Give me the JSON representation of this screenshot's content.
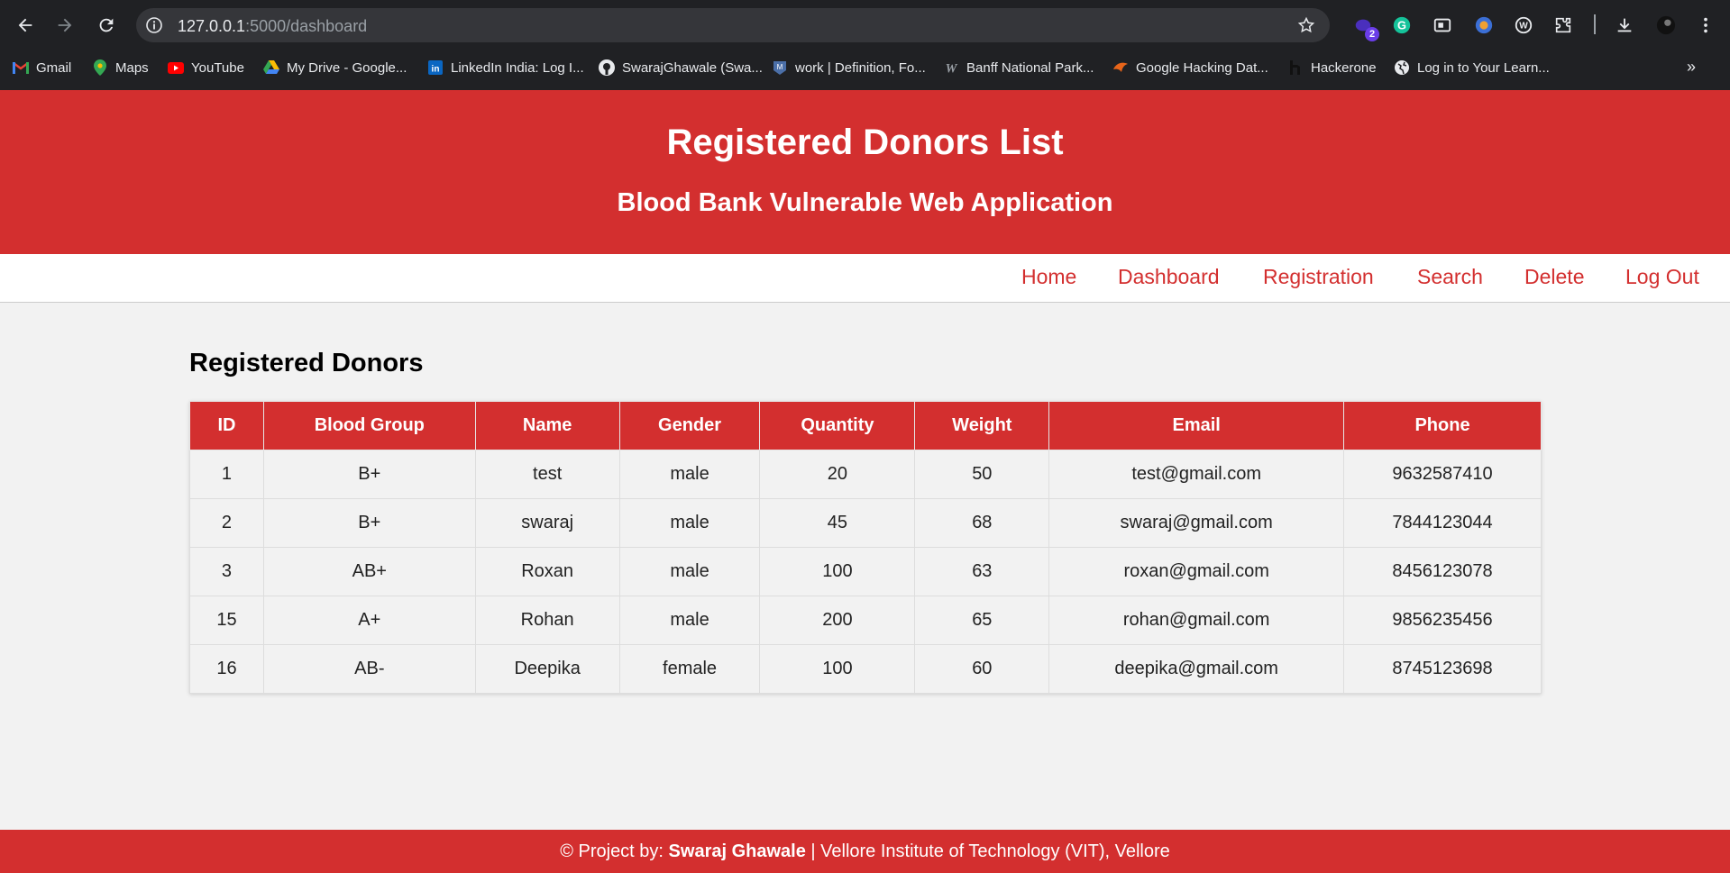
{
  "browser": {
    "url_host": "127.0.0.1",
    "url_path": ":5000/dashboard",
    "extension_badge": "2",
    "bookmarks": [
      {
        "label": "Gmail",
        "icon": "gmail-icon"
      },
      {
        "label": "Maps",
        "icon": "maps-icon"
      },
      {
        "label": "YouTube",
        "icon": "youtube-icon"
      },
      {
        "label": "My Drive - Google...",
        "icon": "drive-icon"
      },
      {
        "label": "LinkedIn India: Log I...",
        "icon": "linkedin-icon"
      },
      {
        "label": "SwarajGhawale (Swa...",
        "icon": "github-icon"
      },
      {
        "label": "work | Definition, Fo...",
        "icon": "dictionary-icon"
      },
      {
        "label": "Banff National Park...",
        "icon": "w-icon"
      },
      {
        "label": "Google Hacking Dat...",
        "icon": "exploitdb-icon"
      },
      {
        "label": "Hackerone",
        "icon": "hackerone-icon"
      },
      {
        "label": "Log in to Your Learn...",
        "icon": "globe-icon"
      }
    ],
    "more_bookmarks": "»"
  },
  "header": {
    "title": "Registered Donors List",
    "subtitle": "Blood Bank Vulnerable Web Application"
  },
  "nav": {
    "links": [
      "Home",
      "Dashboard",
      "Registration",
      "Search",
      "Delete",
      "Log Out"
    ]
  },
  "main": {
    "section_title": "Registered Donors",
    "columns": [
      "ID",
      "Blood Group",
      "Name",
      "Gender",
      "Quantity",
      "Weight",
      "Email",
      "Phone"
    ],
    "rows": [
      [
        "1",
        "B+",
        "test",
        "male",
        "20",
        "50",
        "test@gmail.com",
        "9632587410"
      ],
      [
        "2",
        "B+",
        "swaraj",
        "male",
        "45",
        "68",
        "swaraj@gmail.com",
        "7844123044"
      ],
      [
        "3",
        "AB+",
        "Roxan",
        "male",
        "100",
        "63",
        "roxan@gmail.com",
        "8456123078"
      ],
      [
        "15",
        "A+",
        "Rohan",
        "male",
        "200",
        "65",
        "rohan@gmail.com",
        "9856235456"
      ],
      [
        "16",
        "AB-",
        "Deepika",
        "female",
        "100",
        "60",
        "deepika@gmail.com",
        "8745123698"
      ]
    ]
  },
  "footer": {
    "prefix": "© Project by: ",
    "author": "Swaraj Ghawale",
    "suffix": " | Vellore Institute of Technology (VIT), Vellore"
  },
  "colors": {
    "brand_red": "#d32f2f",
    "page_bg": "#f2f2f2",
    "chrome_bg": "#202124"
  }
}
